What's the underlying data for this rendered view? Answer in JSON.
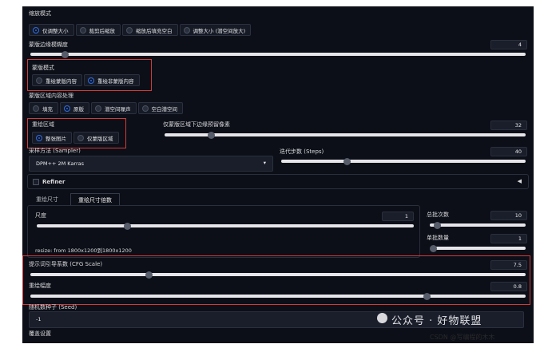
{
  "resize_mode": {
    "label": "缩放模式",
    "options": [
      "仅调整大小",
      "裁剪后缩放",
      "缩放后填充空白",
      "调整大小 (潜空间放大)"
    ],
    "selected": 0
  },
  "mask_blur": {
    "label": "蒙版边缘模糊度",
    "value": "4",
    "level": 0.07
  },
  "mask_mode": {
    "label": "蒙版模式",
    "options": [
      "重绘蒙版内容",
      "重绘非蒙版内容"
    ],
    "selected": 1
  },
  "masked_content": {
    "label": "蒙版区域内容处理",
    "options": [
      "填充",
      "原版",
      "潜空间噪声",
      "空白潜空间"
    ],
    "selected": 1
  },
  "inpaint_area": {
    "label": "重绘区域",
    "options": [
      "整张图片",
      "仅蒙版区域"
    ],
    "selected": 0
  },
  "only_masked_padding": {
    "label": "仅蒙版区域下边缘预留像素",
    "value": "32",
    "level": 0.13
  },
  "sampler": {
    "label": "采样方法 (Sampler)",
    "value": "DPM++ 2M Karras",
    "arrow": "▾"
  },
  "steps": {
    "label": "迭代步数 (Steps)",
    "value": "40",
    "level": 0.27
  },
  "refiner": {
    "label": "Refiner",
    "arrow": "◀"
  },
  "size_tabs": {
    "tabs": [
      "重绘尺寸",
      "重绘尺寸倍数"
    ],
    "active": 1
  },
  "scale": {
    "label": "尺度",
    "value": "1",
    "level": 0.24,
    "resize_note": "resize: from 1800x1200到1800x1200"
  },
  "batch_count": {
    "label": "总批次数",
    "value": "10",
    "level": 0.08
  },
  "batch_size": {
    "label": "单批数量",
    "value": "1",
    "level": 0.0
  },
  "cfg_scale": {
    "label": "提示词引导系数 (CFG Scale)",
    "value": "7.5",
    "level": 0.24
  },
  "denoising": {
    "label": "重绘幅度",
    "value": "0.8",
    "level": 0.8
  },
  "seed": {
    "label": "随机数种子 (Seed)",
    "value": "-1"
  },
  "override": {
    "label": "覆盖设置"
  },
  "watermark": {
    "text": "公众号 · 好物联盟",
    "credit": "CSDN @写编程的木木"
  },
  "colors": {
    "accent": "#2f6be0",
    "highlight": "#d23a3a",
    "panel": "#0c0f17"
  }
}
